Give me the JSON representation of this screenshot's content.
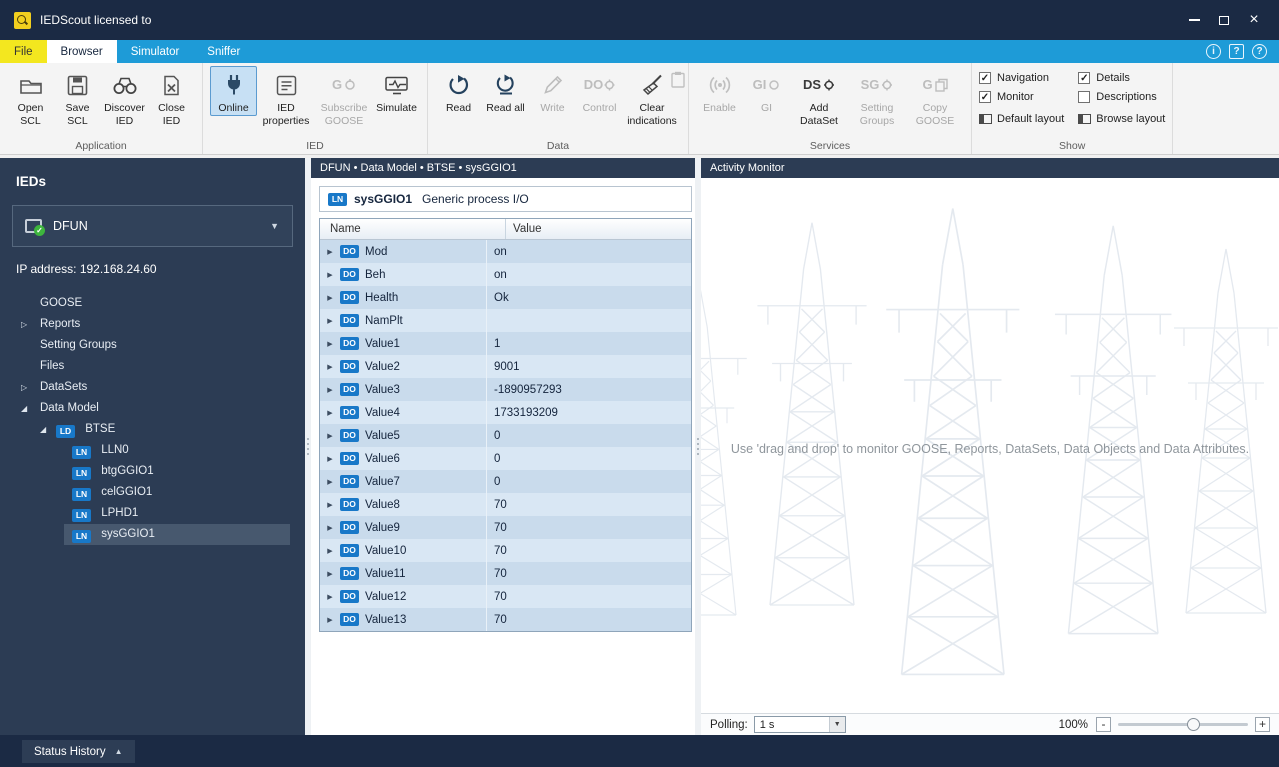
{
  "window": {
    "title": "IEDScout licensed to"
  },
  "tabs": {
    "file": "File",
    "browser": "Browser",
    "simulator": "Simulator",
    "sniffer": "Sniffer"
  },
  "topright": {
    "info_glyph": "i",
    "feedback_glyph": "?",
    "help_glyph": "?"
  },
  "ribbon": {
    "application": {
      "label": "Application",
      "open_scl": "Open SCL",
      "save_scl": "Save SCL",
      "discover_ied": "Discover IED",
      "close_ied": "Close IED"
    },
    "ied": {
      "label": "IED",
      "online": "Online",
      "ied_properties": "IED properties",
      "subscribe_goose": "Subscribe GOOSE",
      "simulate": "Simulate"
    },
    "data": {
      "label": "Data",
      "read": "Read",
      "read_all": "Read all",
      "write": "Write",
      "control": "Control",
      "clear_indications": "Clear indications"
    },
    "services": {
      "label": "Services",
      "enable": "Enable",
      "gi": "GI",
      "add_dataset": "Add DataSet",
      "setting_groups": "Setting Groups",
      "copy_goose": "Copy GOOSE"
    },
    "show": {
      "label": "Show",
      "items": [
        {
          "label": "Navigation",
          "check": "✓"
        },
        {
          "label": "Monitor",
          "check": "✓"
        },
        {
          "label": "Details",
          "check": "✓"
        },
        {
          "label": "Descriptions",
          "check": ""
        }
      ],
      "default_layout": "Default layout",
      "browse_layout": "Browse layout"
    },
    "icon_letters": {
      "g": "G",
      "ds": "DS",
      "sg": "SG",
      "do": "DO",
      "gi": "GI"
    }
  },
  "sidebar": {
    "title": "IEDs",
    "ied_name": "DFUN",
    "ip_label": "IP address:",
    "ip_value": "192.168.24.60",
    "tree": [
      {
        "label": "GOOSE"
      },
      {
        "label": "Reports"
      },
      {
        "label": "Setting Groups"
      },
      {
        "label": "Files"
      },
      {
        "label": "DataSets"
      },
      {
        "label": "Data Model"
      },
      {
        "label": "BTSE"
      },
      {
        "label": "LLN0"
      },
      {
        "label": "btgGGIO1"
      },
      {
        "label": "celGGIO1"
      },
      {
        "label": "LPHD1"
      },
      {
        "label": "sysGGIO1"
      }
    ]
  },
  "glyphs": {
    "collapsed": "▷",
    "expanded": "◢",
    "row_expander": "▶",
    "combo_arrow": "▼",
    "up_arrow": "▲",
    "dropdown_arrow": "▼",
    "badge_ln": "LN",
    "badge_ld": "LD",
    "badge_do": "DO"
  },
  "middle": {
    "breadcrumb": "DFUN • Data Model • BTSE • sysGGIO1",
    "ln_name": "sysGGIO1",
    "ln_description": "Generic process I/O",
    "columns": {
      "name": "Name",
      "value": "Value"
    },
    "rows": [
      {
        "name": "Mod",
        "value": "on"
      },
      {
        "name": "Beh",
        "value": "on"
      },
      {
        "name": "Health",
        "value": "Ok"
      },
      {
        "name": "NamPlt",
        "value": ""
      },
      {
        "name": "Value1",
        "value": "1"
      },
      {
        "name": "Value2",
        "value": "9001"
      },
      {
        "name": "Value3",
        "value": "-1890957293"
      },
      {
        "name": "Value4",
        "value": "1733193209"
      },
      {
        "name": "Value5",
        "value": "0"
      },
      {
        "name": "Value6",
        "value": "0"
      },
      {
        "name": "Value7",
        "value": "0"
      },
      {
        "name": "Value8",
        "value": "70"
      },
      {
        "name": "Value9",
        "value": "70"
      },
      {
        "name": "Value10",
        "value": "70"
      },
      {
        "name": "Value11",
        "value": "70"
      },
      {
        "name": "Value12",
        "value": "70"
      },
      {
        "name": "Value13",
        "value": "70"
      }
    ]
  },
  "activity": {
    "title": "Activity Monitor",
    "hint": "Use 'drag and drop' to monitor GOOSE, Reports, DataSets, Data Objects and Data Attributes.",
    "polling_label": "Polling:",
    "polling_value": "1 s",
    "zoom_value": "100%",
    "zoom_minus": "-",
    "zoom_plus": "+"
  },
  "statusbar": {
    "status_history": "Status History"
  }
}
